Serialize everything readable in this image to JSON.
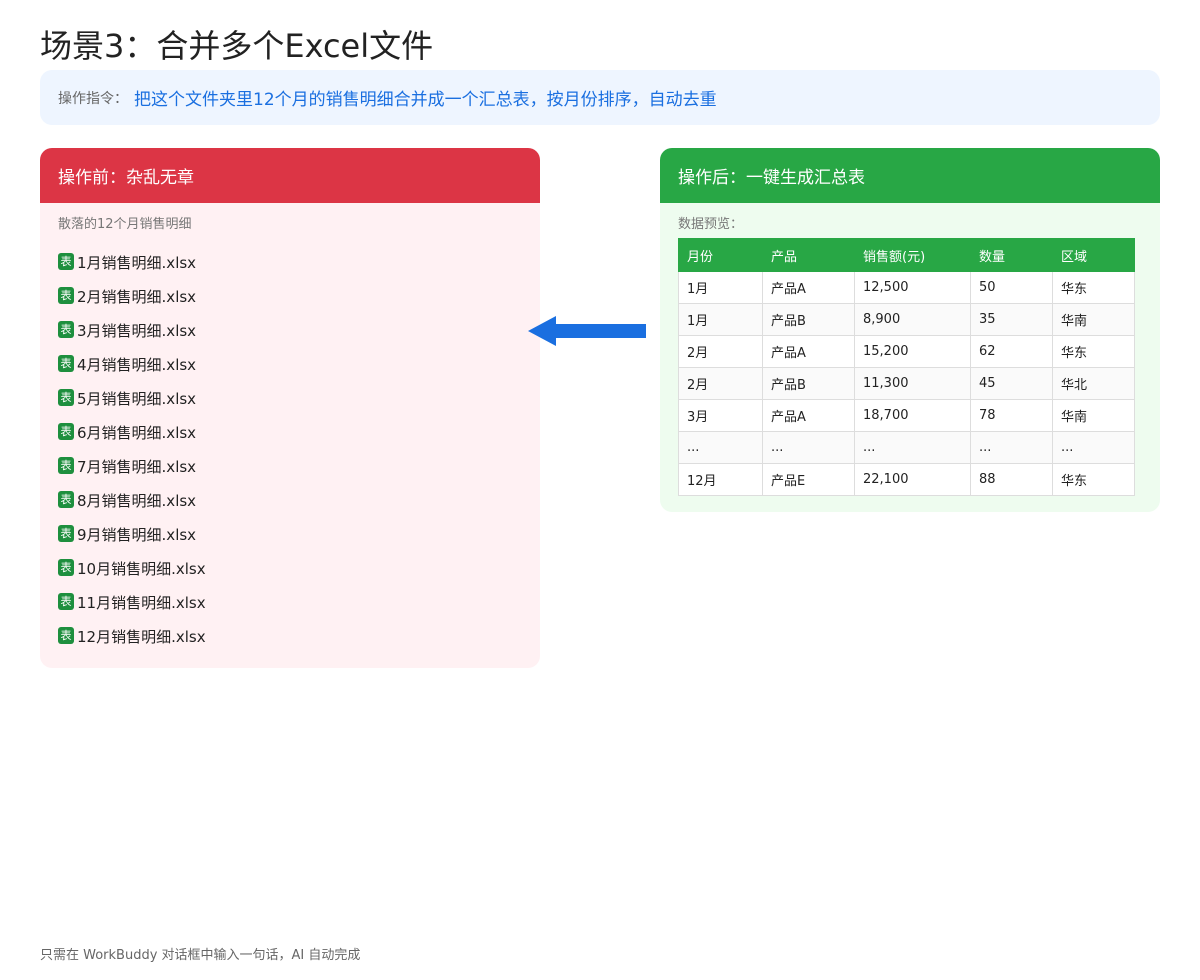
{
  "title": "场景3：合并多个Excel文件",
  "instruction": {
    "label": "操作指令：",
    "text": "把这个文件夹里12个月的销售明细合并成一个汇总表，按月份排序，自动去重"
  },
  "before": {
    "header": "操作前：杂乱无章",
    "subtitle": "散落的12个月销售明细",
    "file_icon_text": "表",
    "files": [
      "1月销售明细.xlsx",
      "2月销售明细.xlsx",
      "3月销售明细.xlsx",
      "4月销售明细.xlsx",
      "5月销售明细.xlsx",
      "6月销售明细.xlsx",
      "7月销售明细.xlsx",
      "8月销售明细.xlsx",
      "9月销售明细.xlsx",
      "10月销售明细.xlsx",
      "11月销售明细.xlsx",
      "12月销售明细.xlsx"
    ]
  },
  "after": {
    "header": "操作后：一键生成汇总表",
    "preview_label": "数据预览：",
    "columns": [
      "月份",
      "产品",
      "销售额(元)",
      "数量",
      "区域"
    ],
    "rows": [
      [
        "1月",
        "产品A",
        "12,500",
        "50",
        "华东"
      ],
      [
        "1月",
        "产品B",
        "8,900",
        "35",
        "华南"
      ],
      [
        "2月",
        "产品A",
        "15,200",
        "62",
        "华东"
      ],
      [
        "2月",
        "产品B",
        "11,300",
        "45",
        "华北"
      ],
      [
        "3月",
        "产品A",
        "18,700",
        "78",
        "华南"
      ],
      [
        "...",
        "...",
        "...",
        "...",
        "..."
      ],
      [
        "12月",
        "产品E",
        "22,100",
        "88",
        "华东"
      ]
    ]
  },
  "footer": "只需在 WorkBuddy 对话框中输入一句话，AI 自动完成",
  "colors": {
    "before_header": "#dc3545",
    "before_bg": "#fff1f3",
    "after_header": "#28a745",
    "after_bg": "#eefcef",
    "instruction_bg": "#eef5ff",
    "instruction_text": "#1a6fe0",
    "arrow": "#1a6fe0",
    "excel_icon": "#1e8f3e"
  },
  "icons": {
    "file": "excel-file-icon",
    "arrow": "arrow-left-icon"
  }
}
